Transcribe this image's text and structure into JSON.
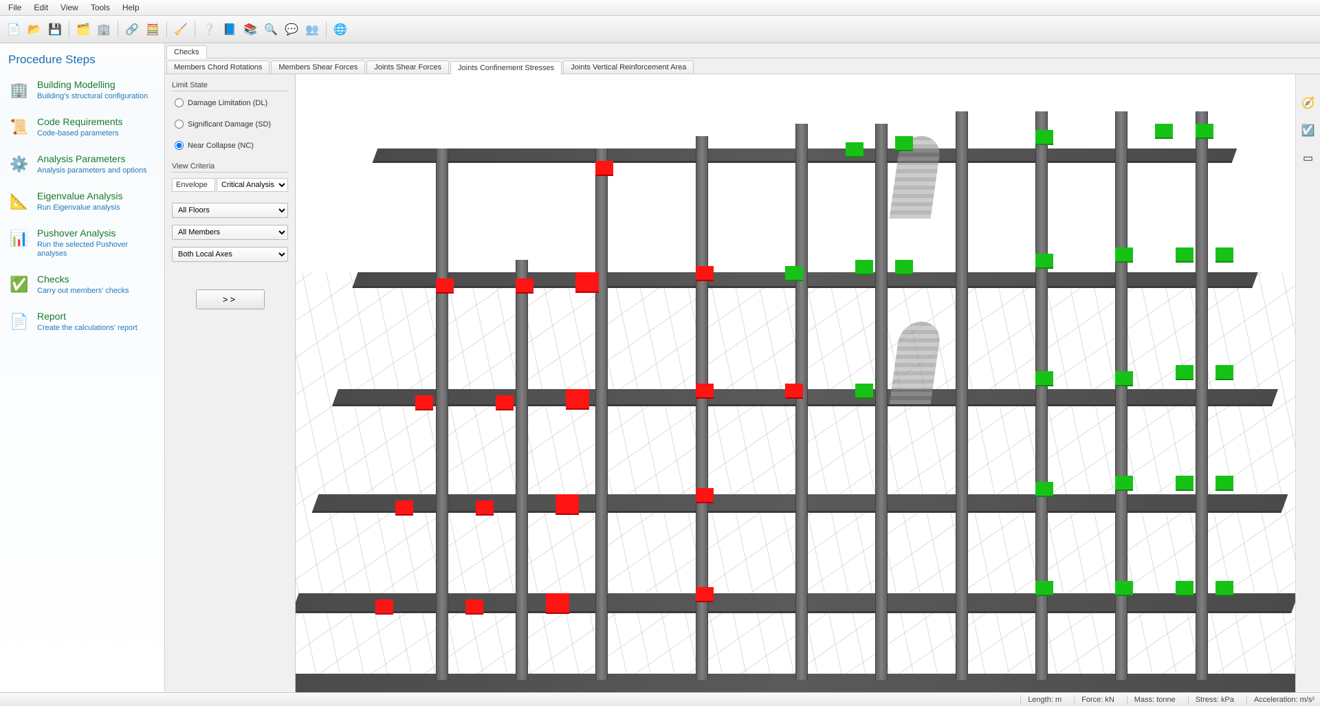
{
  "menu": [
    "File",
    "Edit",
    "View",
    "Tools",
    "Help"
  ],
  "sidebar": {
    "title": "Procedure Steps",
    "steps": [
      {
        "t": "Building Modelling",
        "d": "Building's structural configuration",
        "icon": "🏢"
      },
      {
        "t": "Code Requirements",
        "d": "Code-based parameters",
        "icon": "📜"
      },
      {
        "t": "Analysis Parameters",
        "d": "Analysis parameters and options",
        "icon": "⚙️"
      },
      {
        "t": "Eigenvalue Analysis",
        "d": "Run Eigenvalue analysis",
        "icon": "📐"
      },
      {
        "t": "Pushover Analysis",
        "d": "Run the selected Pushover analyses",
        "icon": "📊"
      },
      {
        "t": "Checks",
        "d": "Carry out members' checks",
        "icon": "✅"
      },
      {
        "t": "Report",
        "d": "Create the calculations' report",
        "icon": "📄"
      }
    ]
  },
  "tabs": {
    "top": "Checks",
    "sub": [
      "Members Chord Rotations",
      "Members Shear Forces",
      "Joints Shear Forces",
      "Joints Confinement Stresses",
      "Joints Vertical Reinforcement Area"
    ],
    "active_sub": 3
  },
  "options": {
    "limit_state_label": "Limit State",
    "ls": [
      "Damage Limitation (DL)",
      "Significant Damage (SD)",
      "Near Collapse (NC)"
    ],
    "ls_selected": 2,
    "view_criteria_label": "View Criteria",
    "envelope_label": "Envelope",
    "analysis": "Critical Analysis",
    "floors": "All Floors",
    "members": "All Members",
    "axes": "Both Local Axes",
    "go": ">>"
  },
  "status": {
    "length": "Length: m",
    "force": "Force: kN",
    "mass": "Mass: tonne",
    "stress": "Stress: kPa",
    "accel": "Acceleration: m/s²"
  }
}
